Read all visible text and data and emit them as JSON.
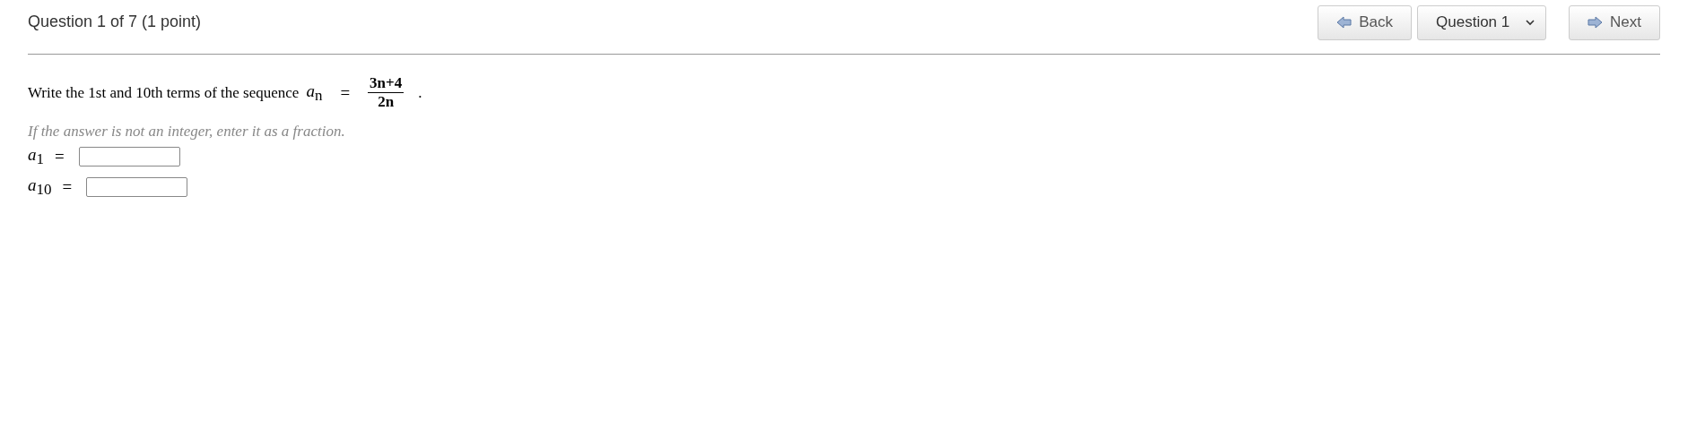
{
  "header": {
    "title": "Question 1 of 7 (1 point)"
  },
  "nav": {
    "back": "Back",
    "question_select": "Question 1",
    "next": "Next"
  },
  "question": {
    "prompt": "Write the 1st and 10th terms of the sequence",
    "formula": {
      "var": "a",
      "sub": "n",
      "equals": "=",
      "numerator": "3n+4",
      "denominator": "2n",
      "end": "."
    },
    "hint": "If the answer is not an integer, enter it as a fraction.",
    "answers": [
      {
        "var": "a",
        "sub": "1",
        "equals": "="
      },
      {
        "var": "a",
        "sub": "10",
        "equals": "="
      }
    ]
  }
}
